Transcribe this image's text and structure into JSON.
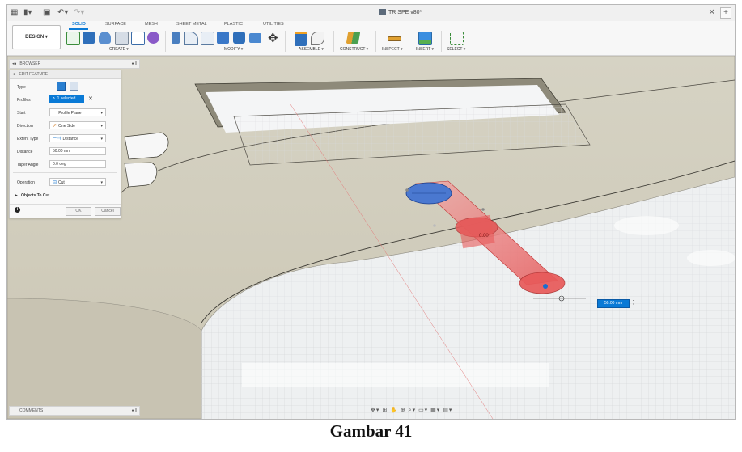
{
  "window": {
    "title": "TR SPE v80*"
  },
  "workspace": {
    "label": "DESIGN ▾"
  },
  "tabs": [
    "SOLID",
    "SURFACE",
    "MESH",
    "SHEET METAL",
    "PLASTIC",
    "UTILITIES"
  ],
  "groups": [
    "CREATE ▾",
    "MODIFY ▾",
    "ASSEMBLE ▾",
    "CONSTRUCT ▾",
    "INSPECT ▾",
    "INSERT ▾",
    "SELECT ▾"
  ],
  "browser": {
    "label": "BROWSER"
  },
  "edit_feature": {
    "title": "EDIT FEATURE",
    "type_label": "Type",
    "profiles_label": "Profiles",
    "profiles_value": "1 selected",
    "start_label": "Start",
    "start_value": "Profile Plane",
    "direction_label": "Direction",
    "direction_value": "One Side",
    "extent_label": "Extent Type",
    "extent_value": "Distance",
    "distance_label": "Distance",
    "distance_value": "50.00 mm",
    "taper_label": "Taper Angle",
    "taper_value": "0.0 deg",
    "operation_label": "Operation",
    "operation_value": "Cut",
    "objects_label": "Objects To Cut",
    "ok": "OK",
    "cancel": "Cancel"
  },
  "viewport": {
    "distance_input": "50.00 mm",
    "sketch_label": "0.00"
  },
  "comments": {
    "label": "COMMENTS"
  },
  "caption": "Gambar 41",
  "colors": {
    "accent": "#0a7ad6",
    "cut_preview": "#e85a5a",
    "profile": "#4a78d0"
  }
}
